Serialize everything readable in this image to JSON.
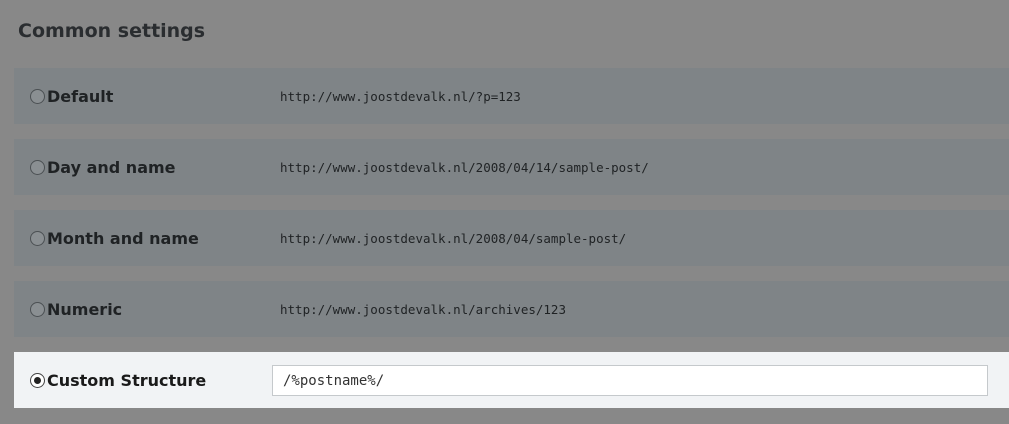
{
  "section": {
    "title": "Common settings"
  },
  "options": [
    {
      "label": "Default",
      "example": "http://www.joostdevalk.nl/?p=123",
      "selected": false
    },
    {
      "label": "Day and name",
      "example": "http://www.joostdevalk.nl/2008/04/14/sample-post/",
      "selected": false
    },
    {
      "label": "Month and name",
      "example": "http://www.joostdevalk.nl/2008/04/sample-post/",
      "selected": false
    },
    {
      "label": "Numeric",
      "example": "http://www.joostdevalk.nl/archives/123",
      "selected": false
    }
  ],
  "custom": {
    "label": "Custom Structure",
    "value": "/%postname%/",
    "selected": true
  }
}
